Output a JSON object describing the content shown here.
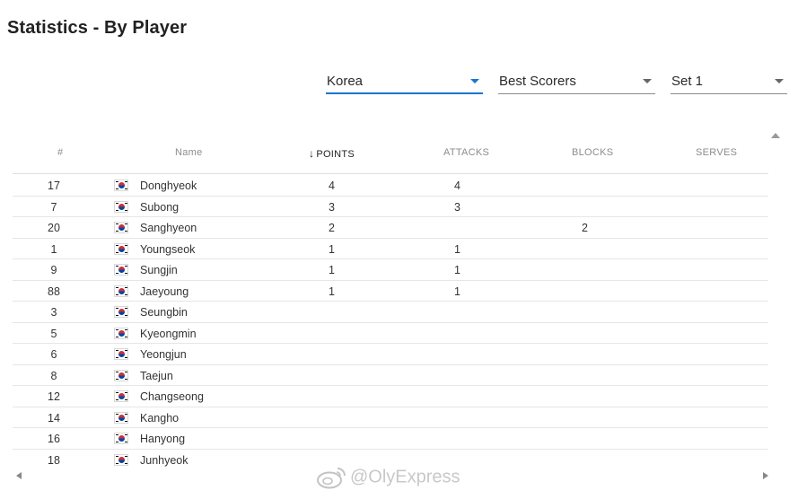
{
  "page": {
    "title": "Statistics - By Player"
  },
  "filters": {
    "team": {
      "value": "Korea"
    },
    "category": {
      "value": "Best Scorers"
    },
    "set": {
      "value": "Set 1"
    }
  },
  "table": {
    "columns": [
      "#",
      "Name",
      "POINTS",
      "ATTACKS",
      "BLOCKS",
      "SERVES"
    ],
    "sorted_column": "POINTS",
    "sort_direction": "descending",
    "rows": [
      {
        "num": "17",
        "name": "Donghyeok",
        "points": "4",
        "attacks": "4",
        "blocks": "",
        "serves": ""
      },
      {
        "num": "7",
        "name": "Subong",
        "points": "3",
        "attacks": "3",
        "blocks": "",
        "serves": ""
      },
      {
        "num": "20",
        "name": "Sanghyeon",
        "points": "2",
        "attacks": "",
        "blocks": "2",
        "serves": ""
      },
      {
        "num": "1",
        "name": "Youngseok",
        "points": "1",
        "attacks": "1",
        "blocks": "",
        "serves": ""
      },
      {
        "num": "9",
        "name": "Sungjin",
        "points": "1",
        "attacks": "1",
        "blocks": "",
        "serves": ""
      },
      {
        "num": "88",
        "name": "Jaeyoung",
        "points": "1",
        "attacks": "1",
        "blocks": "",
        "serves": ""
      },
      {
        "num": "3",
        "name": "Seungbin",
        "points": "",
        "attacks": "",
        "blocks": "",
        "serves": ""
      },
      {
        "num": "5",
        "name": "Kyeongmin",
        "points": "",
        "attacks": "",
        "blocks": "",
        "serves": ""
      },
      {
        "num": "6",
        "name": "Yeongjun",
        "points": "",
        "attacks": "",
        "blocks": "",
        "serves": ""
      },
      {
        "num": "8",
        "name": "Taejun",
        "points": "",
        "attacks": "",
        "blocks": "",
        "serves": ""
      },
      {
        "num": "12",
        "name": "Changseong",
        "points": "",
        "attacks": "",
        "blocks": "",
        "serves": ""
      },
      {
        "num": "14",
        "name": "Kangho",
        "points": "",
        "attacks": "",
        "blocks": "",
        "serves": ""
      },
      {
        "num": "16",
        "name": "Hanyong",
        "points": "",
        "attacks": "",
        "blocks": "",
        "serves": ""
      },
      {
        "num": "18",
        "name": "Junhyeok",
        "points": "",
        "attacks": "",
        "blocks": "",
        "serves": ""
      }
    ]
  },
  "flag_icon": "korea-flag-icon",
  "colors": {
    "accent": "#1976d2",
    "divider": "#e6e6e6",
    "header_text": "#8c8c8c"
  },
  "watermark": {
    "text": "@OlyExpress"
  }
}
